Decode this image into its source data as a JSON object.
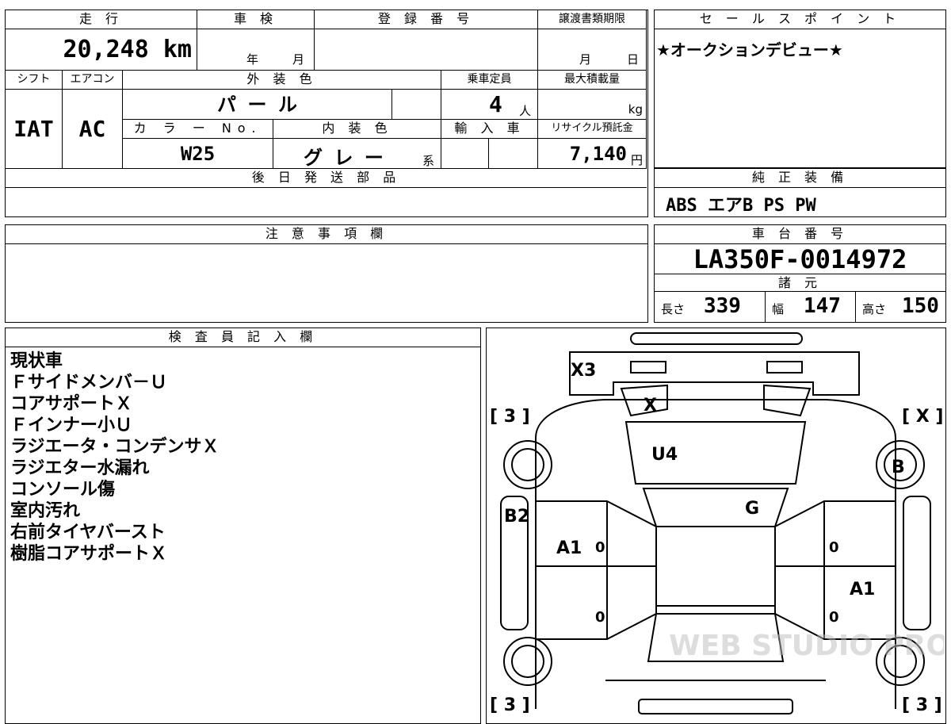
{
  "spec_table": {
    "mileage_header": "走 行",
    "mileage_value": "20,248 km",
    "inspection_header": "車 検",
    "inspection_year_unit": "年",
    "inspection_month_unit": "月",
    "registration_header": "登 録 番 号",
    "transfer_deadline_header": "譲渡書類期限",
    "transfer_month_unit": "月",
    "transfer_day_unit": "日",
    "shift_header": "シフト",
    "shift_value": "IAT",
    "aircon_header": "エアコン",
    "aircon_value": "AC",
    "exterior_color_header": "外 装 色",
    "exterior_color_value": "パ ー ル",
    "capacity_header": "乗車定員",
    "capacity_value": "4",
    "capacity_unit": "人",
    "max_load_header": "最大積載量",
    "max_load_unit": "kg",
    "color_no_header": "カ ラ ー No.",
    "color_no_value": "W25",
    "interior_color_header": "内 装 色",
    "interior_color_value": "グ レ ー",
    "interior_color_suffix": "系",
    "import_header": "輸 入 車",
    "recycle_header": "リサイクル預託金",
    "recycle_value": "7,140",
    "recycle_unit": "円",
    "later_parts_header": "後 日 発 送 部 品"
  },
  "sales_point": {
    "header": "セ ー ル ス ポ イ ン ト",
    "text": "★オークションデビュー★"
  },
  "equipment": {
    "header": "純 正 装 備",
    "items": "ABS エアB PS PW"
  },
  "notes": {
    "header": "注 意 事 項 欄"
  },
  "chassis": {
    "header": "車 台 番 号",
    "number": "LA350F-0014972",
    "dimensions_header": "諸 元",
    "length_label": "長さ",
    "length_value": "339",
    "width_label": "幅",
    "width_value": "147",
    "height_label": "高さ",
    "height_value": "150"
  },
  "inspector": {
    "header": "検 査 員 記 入 欄",
    "lines": [
      "現状車",
      "Ｆサイドメンバ－Ｕ",
      "コアサポートＸ",
      "Ｆインナー小Ｕ",
      "ラジエータ・コンデンサＸ",
      "ラジエター水漏れ",
      "コンソール傷",
      "室内汚れ",
      "右前タイヤバースト",
      "樹脂コアサポートＸ"
    ]
  },
  "diagram": {
    "marks": {
      "front_bumper": "X3",
      "headlight": "X",
      "hood": "U4",
      "front_left_tire_grade": "[ 3 ]",
      "front_right_tire_grade": "[ X ]",
      "right_front_wheel": "B",
      "left_front_fender": "B2",
      "windshield": "G",
      "left_front_door": "A1",
      "right_rear_door": "A1",
      "door_handle_lf": "0",
      "door_handle_lr": "0",
      "door_handle_rf": "0",
      "door_handle_rr": "0",
      "rear_left_tire_grade": "[ 3 ]",
      "rear_right_tire_grade": "[ 3 ]"
    },
    "watermark": "WEB STUDIO PRO"
  }
}
